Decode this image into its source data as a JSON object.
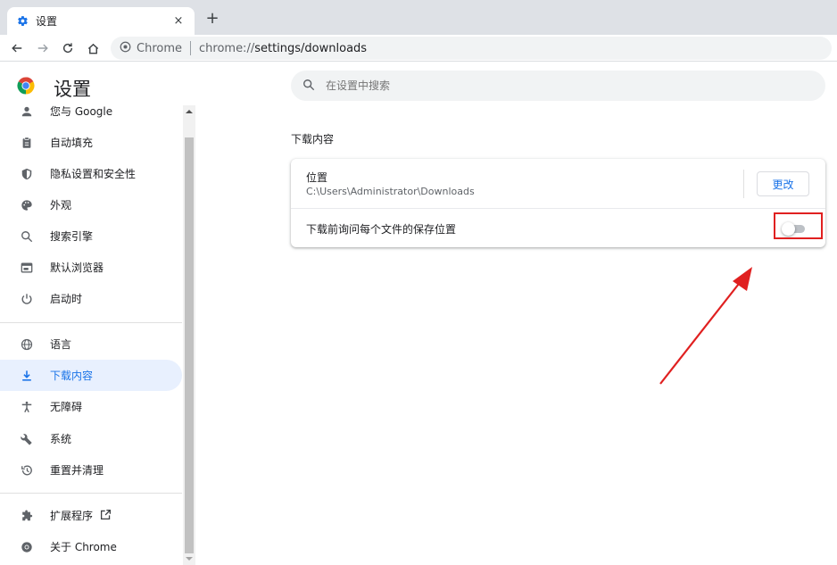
{
  "browser": {
    "tab_title": "设置",
    "tab_close": "×",
    "new_tab": "+",
    "omnibox": {
      "chip": "Chrome",
      "url_scheme": "chrome://",
      "url_path": "settings/downloads"
    }
  },
  "header": {
    "title": "设置",
    "search_placeholder": "在设置中搜索"
  },
  "sidebar": {
    "items": [
      {
        "label": "您与 Google",
        "icon": "person-icon"
      },
      {
        "label": "自动填充",
        "icon": "clipboard-icon"
      },
      {
        "label": "隐私设置和安全性",
        "icon": "shield-icon"
      },
      {
        "label": "外观",
        "icon": "palette-icon"
      },
      {
        "label": "搜索引擎",
        "icon": "search-icon"
      },
      {
        "label": "默认浏览器",
        "icon": "browser-icon"
      },
      {
        "label": "启动时",
        "icon": "power-icon"
      },
      {
        "label": "语言",
        "icon": "globe-icon"
      },
      {
        "label": "下载内容",
        "icon": "download-icon",
        "active": true
      },
      {
        "label": "无障碍",
        "icon": "accessibility-icon"
      },
      {
        "label": "系统",
        "icon": "wrench-icon"
      },
      {
        "label": "重置并清理",
        "icon": "restore-icon"
      },
      {
        "label": "扩展程序",
        "icon": "puzzle-icon"
      },
      {
        "label": "关于 Chrome",
        "icon": "chrome-icon"
      }
    ]
  },
  "downloads": {
    "section_title": "下载内容",
    "location_label": "位置",
    "location_path": "C:\\Users\\Administrator\\Downloads",
    "change_button": "更改",
    "ask_label": "下载前询问每个文件的保存位置",
    "ask_enabled": false
  },
  "colors": {
    "accent": "#1a73e8",
    "active_bg": "#e8f0fe",
    "annotation": "#e02020"
  }
}
